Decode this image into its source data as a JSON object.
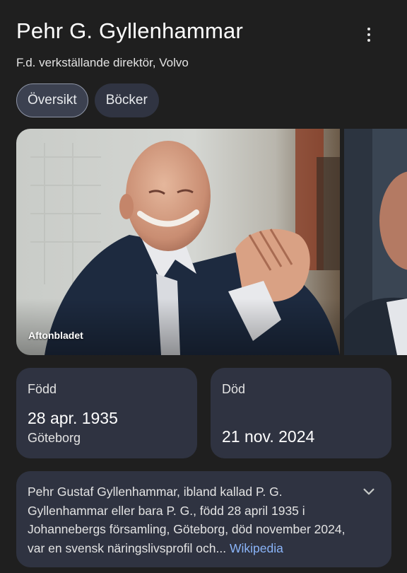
{
  "header": {
    "title": "Pehr G. Gyllenhammar",
    "subtitle": "F.d. verkställande direktör, Volvo",
    "menu_icon": "more-vert-icon"
  },
  "tabs": [
    {
      "label": "Översikt",
      "active": true
    },
    {
      "label": "Böcker",
      "active": false
    }
  ],
  "gallery": {
    "main_photo_credit": "Aftonbladet"
  },
  "facts": {
    "born": {
      "label": "Född",
      "date": "28 apr. 1935",
      "place": "Göteborg"
    },
    "died": {
      "label": "Död",
      "date": "21 nov. 2024"
    }
  },
  "description": {
    "text": "Pehr Gustaf Gyllenhammar, ibland kallad P. G. Gyllenhammar eller bara P. G., född 28 april 1935 i Johannebergs församling, Göteborg, död november 2024, var en svensk näringslivsprofil och",
    "ellipsis": "... ",
    "source": "Wikipedia",
    "expand_icon": "chevron-down-icon"
  },
  "colors": {
    "background": "#1f1f1f",
    "card": "#2f3341",
    "link": "#8ab4f8"
  }
}
